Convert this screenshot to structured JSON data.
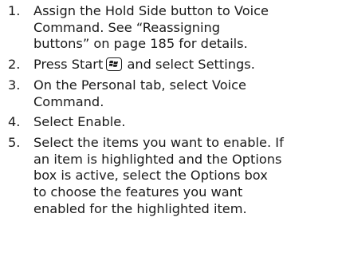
{
  "steps": [
    {
      "number": "1.",
      "lines": [
        "Assign the Hold Side button to Voice",
        "Command. See “Reassigning",
        "buttons” on page 185 for details."
      ]
    },
    {
      "number": "2.",
      "before_icon": "Press Start",
      "icon": "windows-start-icon",
      "after_icon": "and select Settings."
    },
    {
      "number": "3.",
      "lines": [
        "On the Personal tab, select Voice",
        "Command."
      ]
    },
    {
      "number": "4.",
      "lines": [
        "Select Enable."
      ]
    },
    {
      "number": "5.",
      "lines": [
        "Select the items you want to enable. If",
        "an item is highlighted and the Options",
        "box is active, select the Options box",
        "to choose the features you want",
        "enabled for the highlighted item."
      ]
    }
  ]
}
